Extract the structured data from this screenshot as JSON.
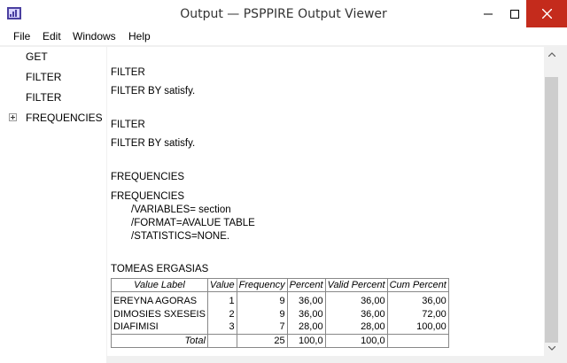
{
  "window": {
    "title": "Output — PSPPIRE Output Viewer",
    "controls": [
      "minimize-icon",
      "maximize-icon",
      "close-icon"
    ]
  },
  "menubar": {
    "items": [
      {
        "label": "File"
      },
      {
        "label": "Edit"
      },
      {
        "label": "Windows"
      },
      {
        "label": "Help"
      }
    ]
  },
  "sidebar": {
    "items": [
      {
        "label": "GET"
      },
      {
        "label": "FILTER"
      },
      {
        "label": "FILTER"
      },
      {
        "label": "FREQUENCIES",
        "expandable": true
      }
    ]
  },
  "output": {
    "filter1_heading": "FILTER",
    "filter1_command": "FILTER BY satisfy.",
    "filter2_heading": "FILTER",
    "filter2_command": "FILTER BY satisfy.",
    "freq_heading": "FREQUENCIES",
    "freq_command": {
      "line1": "FREQUENCIES",
      "line2": "/VARIABLES= section",
      "line3": "/FORMAT=AVALUE TABLE",
      "line4": "/STATISTICS=NONE."
    },
    "table": {
      "caption": "TOMEAS ERGASIAS",
      "columns": [
        "Value Label",
        "Value",
        "Frequency",
        "Percent",
        "Valid Percent",
        "Cum Percent"
      ],
      "rows": [
        {
          "label": "EREYNA AGORAS",
          "value": "1",
          "frequency": "9",
          "percent": "36,00",
          "valid": "36,00",
          "cum": "36,00"
        },
        {
          "label": "DIMOSIES SXESEIS",
          "value": "2",
          "frequency": "9",
          "percent": "36,00",
          "valid": "36,00",
          "cum": "72,00"
        },
        {
          "label": "DIAFIMISI",
          "value": "3",
          "frequency": "7",
          "percent": "28,00",
          "valid": "28,00",
          "cum": "100,00"
        }
      ],
      "total": {
        "label": "Total",
        "frequency": "25",
        "percent": "100,0",
        "valid": "100,0",
        "cum": ""
      }
    }
  },
  "colors": {
    "close_button": "#c42b1c",
    "scrollbar_thumb": "#cdcdcd"
  }
}
